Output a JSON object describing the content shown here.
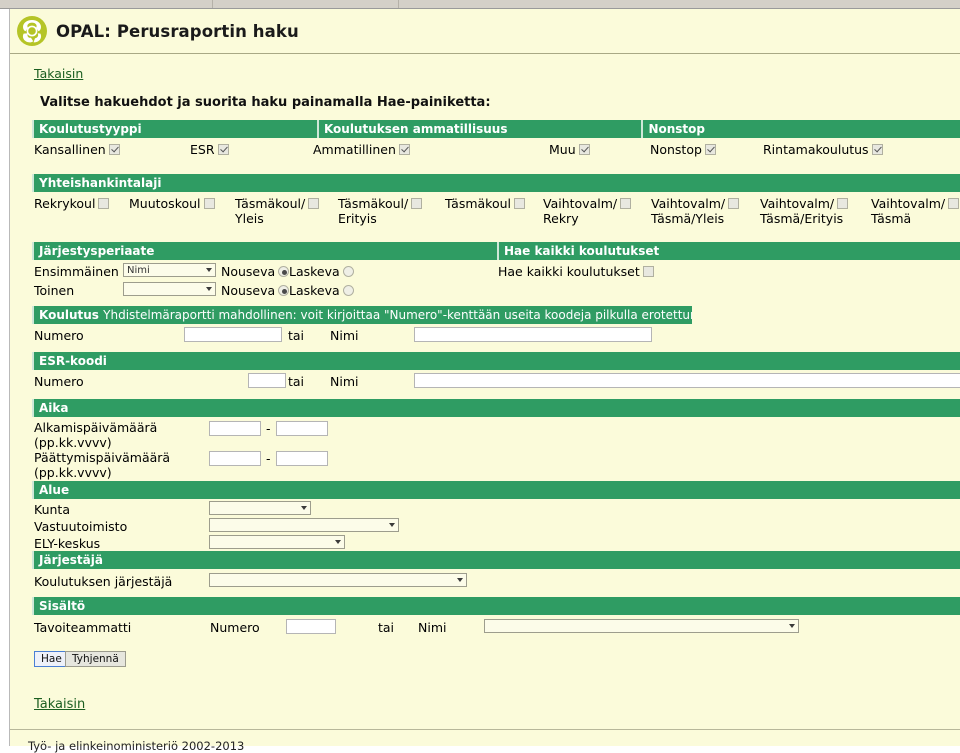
{
  "app": {
    "title": "OPAL: Perusraportin haku",
    "logo_icon": "opal-trefoil-logo-icon"
  },
  "top_link": "Takaisin",
  "instruction": "Valitse hakuehdot ja suorita haku painamalla Hae-painiketta:",
  "sections": {
    "koulutustyyppi": {
      "header": "Koulutustyyppi",
      "options": [
        {
          "label": "Kansallinen",
          "checked": true
        },
        {
          "label": "ESR",
          "checked": true
        }
      ]
    },
    "ammatillisuus": {
      "header": "Koulutuksen ammatillisuus",
      "options": [
        {
          "label": "Ammatillinen",
          "checked": true
        },
        {
          "label": "Muu",
          "checked": true
        }
      ]
    },
    "nonstop": {
      "header": "Nonstop",
      "options": [
        {
          "label": "Nonstop",
          "checked": true
        },
        {
          "label": "Rintamakoulutus",
          "checked": true
        }
      ]
    },
    "yhteishankintalaji": {
      "header": "Yhteishankintalaji",
      "options": [
        {
          "label": "Rekrykoul",
          "checked": false
        },
        {
          "label": "Muutoskoul",
          "checked": false
        },
        {
          "label": "Täsmäkoul/\nYleis",
          "checked": false
        },
        {
          "label": "Täsmäkoul/\nErityis",
          "checked": false
        },
        {
          "label": "Täsmäkoul",
          "checked": false
        },
        {
          "label": "Vaihtovalm/\nRekry",
          "checked": false
        },
        {
          "label": "Vaihtovalm/\nTäsmä/Yleis",
          "checked": false
        },
        {
          "label": "Vaihtovalm/\nTäsmä/Erityis",
          "checked": false
        },
        {
          "label": "Vaihtovalm/\nTäsmä",
          "checked": false
        }
      ]
    },
    "jarjestysperiaate": {
      "header": "Järjestysperiaate",
      "rows": [
        {
          "label": "Ensimmäinen",
          "select_value": "Nimi",
          "asc_label": "Nouseva",
          "desc_label": "Laskeva",
          "selected": "asc"
        },
        {
          "label": "Toinen",
          "select_value": "",
          "asc_label": "Nouseva",
          "desc_label": "Laskeva",
          "selected": "asc"
        }
      ]
    },
    "hae_kaikki": {
      "header": "Hae kaikki koulutukset",
      "label": "Hae kaikki koulutukset",
      "checked": false
    },
    "koulutus": {
      "header_strong": "Koulutus",
      "header_note": "Yhdistelmäraportti mahdollinen: voit kirjoittaa \"Numero\"-kenttään useita koodeja pilkulla erotettuna",
      "numero_label": "Numero",
      "numero_value": "",
      "tai_label": "tai",
      "nimi_label": "Nimi",
      "nimi_value": ""
    },
    "esr_koodi": {
      "header": "ESR-koodi",
      "numero_label": "Numero",
      "numero_value": "",
      "tai_label": "tai",
      "nimi_label": "Nimi",
      "nimi_value": ""
    },
    "aika": {
      "header": "Aika",
      "rows": [
        {
          "label_line1": "Alkamispäivämäärä",
          "label_line2": "(pp.kk.vvvv)",
          "from": "",
          "to": "",
          "sep": "-"
        },
        {
          "label_line1": "Päättymispäivämäärä",
          "label_line2": "(pp.kk.vvvv)",
          "from": "",
          "to": "",
          "sep": "-"
        }
      ]
    },
    "alue": {
      "header": "Alue",
      "rows": [
        {
          "label": "Kunta",
          "value": ""
        },
        {
          "label": "Vastuutoimisto",
          "value": ""
        },
        {
          "label": "ELY-keskus",
          "value": ""
        }
      ]
    },
    "jarjestaja": {
      "header": "Järjestäjä",
      "row": {
        "label": "Koulutuksen järjestäjä",
        "value": ""
      }
    },
    "sisalto": {
      "header": "Sisältö",
      "row": {
        "label": "Tavoiteammatti",
        "numero_label": "Numero",
        "numero_value": "",
        "tai_label": "tai",
        "nimi_label": "Nimi",
        "nimi_value": ""
      }
    }
  },
  "buttons": {
    "search": "Hae",
    "clear": "Tyhjennä"
  },
  "bottom_link": "Takaisin",
  "footer": "Työ- ja elinkeinoministeriö 2002-2013",
  "colors": {
    "section_header_bg": "#2f9c63",
    "page_bg": "#fbfbda",
    "link": "#1b5e20"
  }
}
